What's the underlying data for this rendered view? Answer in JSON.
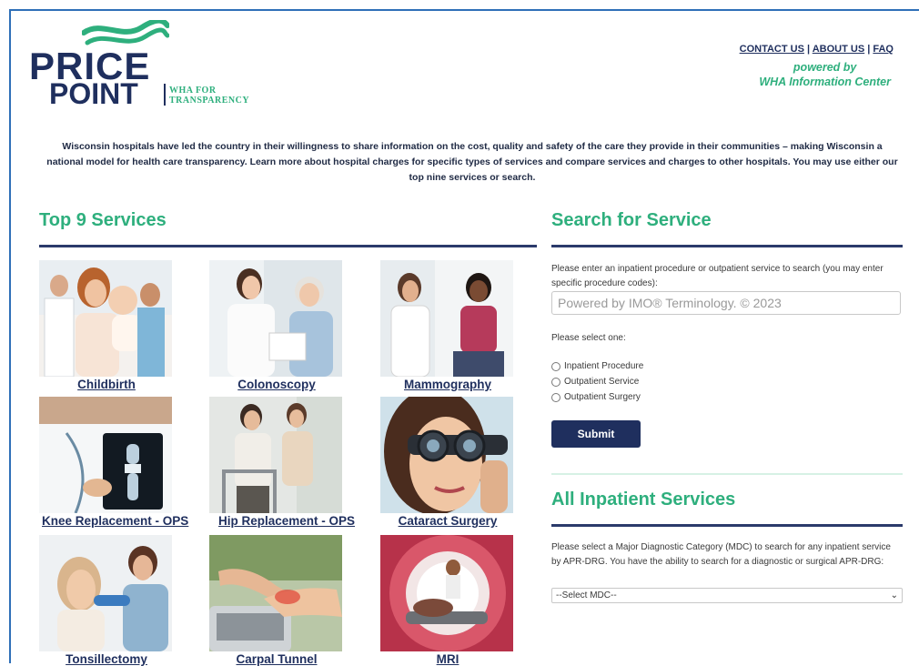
{
  "brand": {
    "price": "PRICE",
    "point": "POINT",
    "tag_line1": "WHA FOR",
    "tag_line2": "TRANSPARENCY",
    "wave_color": "#2eaf7d",
    "navy": "#1f2f5e"
  },
  "nav": {
    "contact": "CONTACT US",
    "about": "ABOUT US",
    "faq": "FAQ",
    "sep": "|"
  },
  "powered": {
    "line1": "powered by",
    "line2": "WHA Information Center"
  },
  "intro": "Wisconsin hospitals have led the country in their willingness to share information on the cost, quality and safety of the care they provide in their communities – making Wisconsin a national model for health care transparency. Learn more about hospital charges for specific types of services and compare services and charges to other hospitals. You may use either our top nine services or search.",
  "top_services": {
    "title": "Top 9 Services",
    "items": [
      {
        "label": "Childbirth",
        "icon": "mother-baby-photo"
      },
      {
        "label": "Colonoscopy",
        "icon": "doctor-patient-photo"
      },
      {
        "label": "Mammography",
        "icon": "consultation-photo"
      },
      {
        "label": "Knee Replacement - OPS",
        "icon": "knee-xray-photo"
      },
      {
        "label": "Hip Replacement - OPS",
        "icon": "walker-patient-photo"
      },
      {
        "label": "Cataract Surgery",
        "icon": "eye-exam-photo"
      },
      {
        "label": "Tonsillectomy",
        "icon": "throat-exam-photo"
      },
      {
        "label": "Carpal Tunnel",
        "icon": "wrist-pain-photo"
      },
      {
        "label": "MRI",
        "icon": "mri-scanner-photo"
      }
    ]
  },
  "search": {
    "title": "Search for Service",
    "hint": "Please enter an inpatient procedure or outpatient service to search (you may enter specific procedure codes):",
    "placeholder": "Powered by IMO® Terminology. © 2023",
    "select_prompt": "Please select one:",
    "options": [
      "Inpatient Procedure",
      "Outpatient Service",
      "Outpatient Surgery"
    ],
    "submit": "Submit"
  },
  "inpatient": {
    "title": "All Inpatient Services",
    "hint": "Please select a Major Diagnostic Category (MDC) to search for any inpatient service by APR-DRG. You have the ability to search for a diagnostic or surgical APR-DRG:",
    "select_value": "--Select MDC--"
  }
}
